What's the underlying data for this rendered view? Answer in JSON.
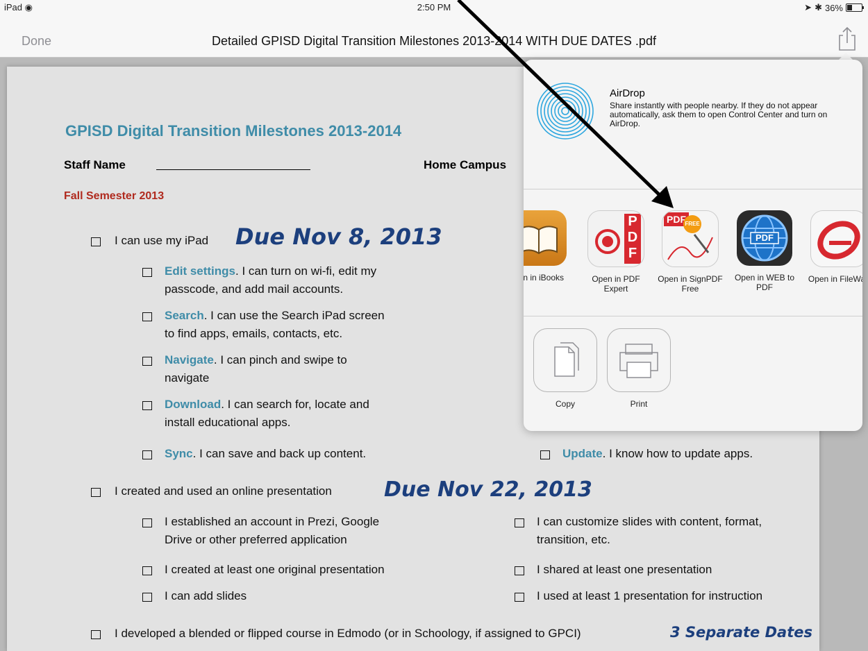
{
  "status": {
    "device": "iPad",
    "time": "2:50 PM",
    "battery": "36%",
    "battery_level": 0.36
  },
  "nav": {
    "done_label": "Done",
    "title": "Detailed GPISD Digital Transition Milestones 2013-2014 WITH DUE DATES .pdf"
  },
  "doc": {
    "heading": "GPISD Digital Transition Milestones 2013-2014",
    "staff_label": "Staff Name",
    "campus_label": "Home Campus",
    "semester": "Fall Semester 2013",
    "section1": {
      "text": "I can use my iPad",
      "due": "Due Nov 8, 2013",
      "items": [
        {
          "hl": "Edit settings",
          "rest": ". I can turn on wi-fi, edit my",
          "line2": "passcode, and add mail accounts."
        },
        {
          "hl": "Search",
          "rest": ". I can use the Search iPad screen",
          "line2": "to find apps, emails, contacts, etc."
        },
        {
          "hl": "Navigate",
          "rest": ".  I can pinch and swipe to",
          "line2": "navigate"
        },
        {
          "hl": "Download",
          "rest": ". I can search for, locate and",
          "line2": "install educational apps."
        },
        {
          "hl": "Sync",
          "rest": ". I can save and back up content.",
          "line2": ""
        }
      ],
      "update": {
        "hl": "Update",
        "rest": ". I know how to update apps."
      }
    },
    "section2": {
      "text": "I created and used an online presentation",
      "due": "Due Nov 22, 2013",
      "left_items": [
        {
          "line1": "I established an account in Prezi, Google",
          "line2": "Drive or other preferred application"
        },
        {
          "line1": "I created at least one original presentation",
          "line2": ""
        },
        {
          "line1": "I can add slides",
          "line2": ""
        }
      ],
      "right_items": [
        {
          "line1": "I can customize slides with content, format,",
          "line2": "transition, etc."
        },
        {
          "line1": "I shared at least one presentation",
          "line2": ""
        },
        {
          "line1": "I used at least 1 presentation for instruction",
          "line2": ""
        }
      ]
    },
    "section3": {
      "text": "I developed a blended or flipped course in Edmodo (or in Schoology, if assigned to GPCI)",
      "due": "3 Separate Dates"
    }
  },
  "share": {
    "airdrop_title": "AirDrop",
    "airdrop_desc": "Share instantly with people nearby. If they do not appear automatically, ask them to open Control Center and turn on AirDrop.",
    "apps": [
      {
        "label": "pen in iBooks",
        "icon": "ibooks-icon"
      },
      {
        "label": "Open in PDF Expert",
        "icon": "pdf-expert-icon"
      },
      {
        "label": "Open in SignPDF Free",
        "icon": "signpdf-icon"
      },
      {
        "label": "Open in WEB to PDF",
        "icon": "web-to-pdf-icon"
      },
      {
        "label": "Open in FileWay",
        "icon": "fileway-icon"
      }
    ],
    "actions": [
      {
        "label": "Copy",
        "icon": "copy-icon"
      },
      {
        "label": "Print",
        "icon": "print-icon"
      }
    ]
  },
  "badges": {
    "pdf_letters": "PDF",
    "pdf_tag": "PDF",
    "free_tag": "FREE"
  },
  "colors": {
    "link_blue": "#3f8ca8",
    "due_navy": "#1c3f7d",
    "semester_red": "#b02a1e"
  }
}
